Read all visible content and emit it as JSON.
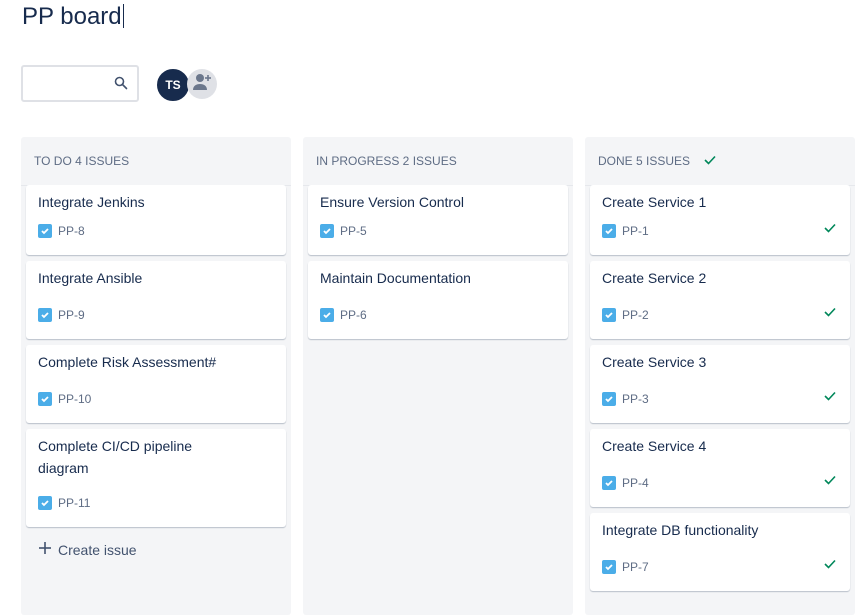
{
  "board": {
    "title": "PP board"
  },
  "search": {
    "placeholder": "",
    "icon": "search-icon"
  },
  "avatars": [
    {
      "initials": "TS",
      "color": "#172b4d"
    }
  ],
  "add_people_icon": "add-person-icon",
  "columns": [
    {
      "header": "TO DO 4 ISSUES",
      "cards": [
        {
          "title": "Integrate Jenkins",
          "key": "PP-8"
        },
        {
          "title": "Integrate Ansible",
          "key": "PP-9"
        },
        {
          "title": "Complete Risk Assessment#",
          "key": "PP-10"
        },
        {
          "title": "Complete CI/CD pipeline diagram",
          "key": "PP-11"
        }
      ],
      "create_label": "Create issue"
    },
    {
      "header": "IN PROGRESS 2 ISSUES",
      "cards": [
        {
          "title": "Ensure Version Control",
          "key": "PP-5"
        },
        {
          "title": "Maintain Documentation",
          "key": "PP-6"
        }
      ]
    },
    {
      "header": "DONE 5 ISSUES",
      "header_icon": "check-icon",
      "cards": [
        {
          "title": "Create Service 1",
          "key": "PP-1"
        },
        {
          "title": "Create Service 2",
          "key": "PP-2"
        },
        {
          "title": "Create Service 3",
          "key": "PP-3"
        },
        {
          "title": "Create Service 4",
          "key": "PP-4"
        },
        {
          "title": "Integrate DB functionality",
          "key": "PP-7"
        }
      ]
    }
  ],
  "colors": {
    "issue_type": "#4bade8",
    "done_check": "#00875a",
    "column_bg": "#f4f5f7",
    "text": "#172b4d"
  }
}
